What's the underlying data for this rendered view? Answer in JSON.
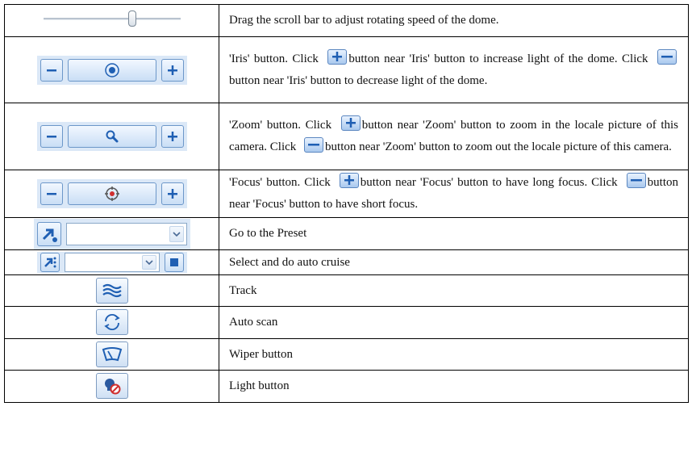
{
  "rows": [
    {
      "control": "speed-slider",
      "desc": "Drag the scroll bar to adjust rotating speed of the dome."
    },
    {
      "control": "iris-controls",
      "desc_parts": [
        "'Iris' button. Click ",
        "button near 'Iris' button to increase light of the dome. Click ",
        "button near 'Iris' button to decrease light of the dome."
      ]
    },
    {
      "control": "zoom-controls",
      "desc_parts": [
        "'Zoom' button. Click ",
        "button near 'Zoom' button to zoom in the locale picture of this camera. Click ",
        "button near 'Zoom' button to zoom out the locale picture of this camera."
      ]
    },
    {
      "control": "focus-controls",
      "desc_parts": [
        "'Focus' button. Click ",
        "button near 'Focus' button to have long focus. Click ",
        "button near 'Focus' button to have short focus."
      ]
    },
    {
      "control": "preset-select",
      "desc": "Go to the Preset"
    },
    {
      "control": "cruise-select",
      "desc": "Select and do auto cruise"
    },
    {
      "control": "track-button",
      "desc": "Track"
    },
    {
      "control": "auto-scan-button",
      "desc": "Auto scan"
    },
    {
      "control": "wiper-button",
      "desc": "Wiper button"
    },
    {
      "control": "light-button",
      "desc": "Light button"
    }
  ],
  "icons": {
    "plus": "plus-icon",
    "minus": "minus-icon",
    "iris": "iris-icon",
    "zoom": "magnifier-icon",
    "focus": "focus-target-icon",
    "preset": "preset-arrow-icon",
    "cruise": "cruise-arrow-icon",
    "stop": "stop-icon",
    "track": "track-waves-icon",
    "scan": "rotate-arrows-icon",
    "wiper": "wiper-icon",
    "light": "light-off-icon"
  },
  "colors": {
    "button_border": "#6c97c9",
    "button_fill": "#c9def5",
    "glyph": "#1f5fb3",
    "light_off": "#d03030"
  }
}
